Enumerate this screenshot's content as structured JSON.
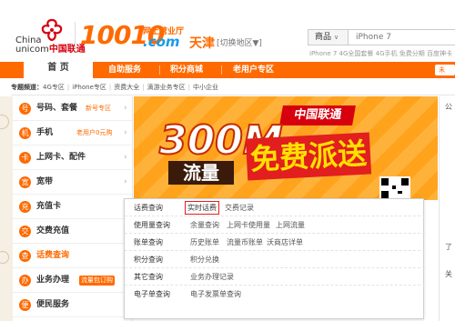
{
  "header": {
    "logo_line1": "China",
    "logo_line2_en": "unicom",
    "logo_line2_cn": "中国联通",
    "brand_number": "10010",
    "brand_sub1": "网上营业厅",
    "brand_sub2": ".com",
    "city": "天津",
    "switch_area": "[切换地区▼]"
  },
  "search": {
    "category": "商品",
    "placeholder": "iPhone 7",
    "hot_words": "iPhone 7   4G全国套餐   4G手机   免费分期   百度神卡"
  },
  "nav": {
    "items": [
      "首 页",
      "自助服务",
      "积分商城",
      "老用户专区"
    ],
    "right_label": "未"
  },
  "zones": {
    "label": "专题频道：",
    "items": [
      "4G专区",
      "iPhone专区",
      "资费大全",
      "滴游业务专区",
      "中小企业"
    ]
  },
  "sidebar": {
    "items": [
      {
        "icon": "号",
        "label": "号码、套餐",
        "promo": "新号专区"
      },
      {
        "icon": "机",
        "label": "手机",
        "promo": "老用户0元购"
      },
      {
        "icon": "卡",
        "label": "上网卡、配件",
        "promo": ""
      },
      {
        "icon": "宽",
        "label": "宽带",
        "promo": ""
      },
      {
        "icon": "充",
        "label": "充值卡",
        "promo": ""
      },
      {
        "icon": "交",
        "label": "交费充值",
        "promo": ""
      },
      {
        "icon": "查",
        "label": "话费查询",
        "promo": ""
      },
      {
        "icon": "办",
        "label": "业务办理",
        "promo": "流量包订购"
      },
      {
        "icon": "便",
        "label": "便民服务",
        "promo": ""
      }
    ]
  },
  "banner": {
    "brand": "中国联通",
    "big_number": "300M",
    "flow": "流量",
    "free": "免费派送"
  },
  "popup": {
    "rows": [
      {
        "head": "话费查询",
        "links": [
          "实时话费",
          "交费记录"
        ]
      },
      {
        "head": "使用量查询",
        "links": [
          "余量查询",
          "上网卡使用量",
          "上网流量"
        ]
      },
      {
        "head": "账单查询",
        "links": [
          "历史账单",
          "流量币账单",
          "沃商店详单"
        ]
      },
      {
        "head": "积分查询",
        "links": [
          "积分兑换"
        ]
      },
      {
        "head": "其它查询",
        "links": [
          "业务办理记录"
        ]
      },
      {
        "head": "电子单查询",
        "links": [
          "电子发票单查询"
        ]
      }
    ]
  },
  "right_col": [
    "公",
    "了",
    "关"
  ],
  "colors": {
    "accent": "#ff6a00",
    "brand_red": "#d7000f"
  }
}
